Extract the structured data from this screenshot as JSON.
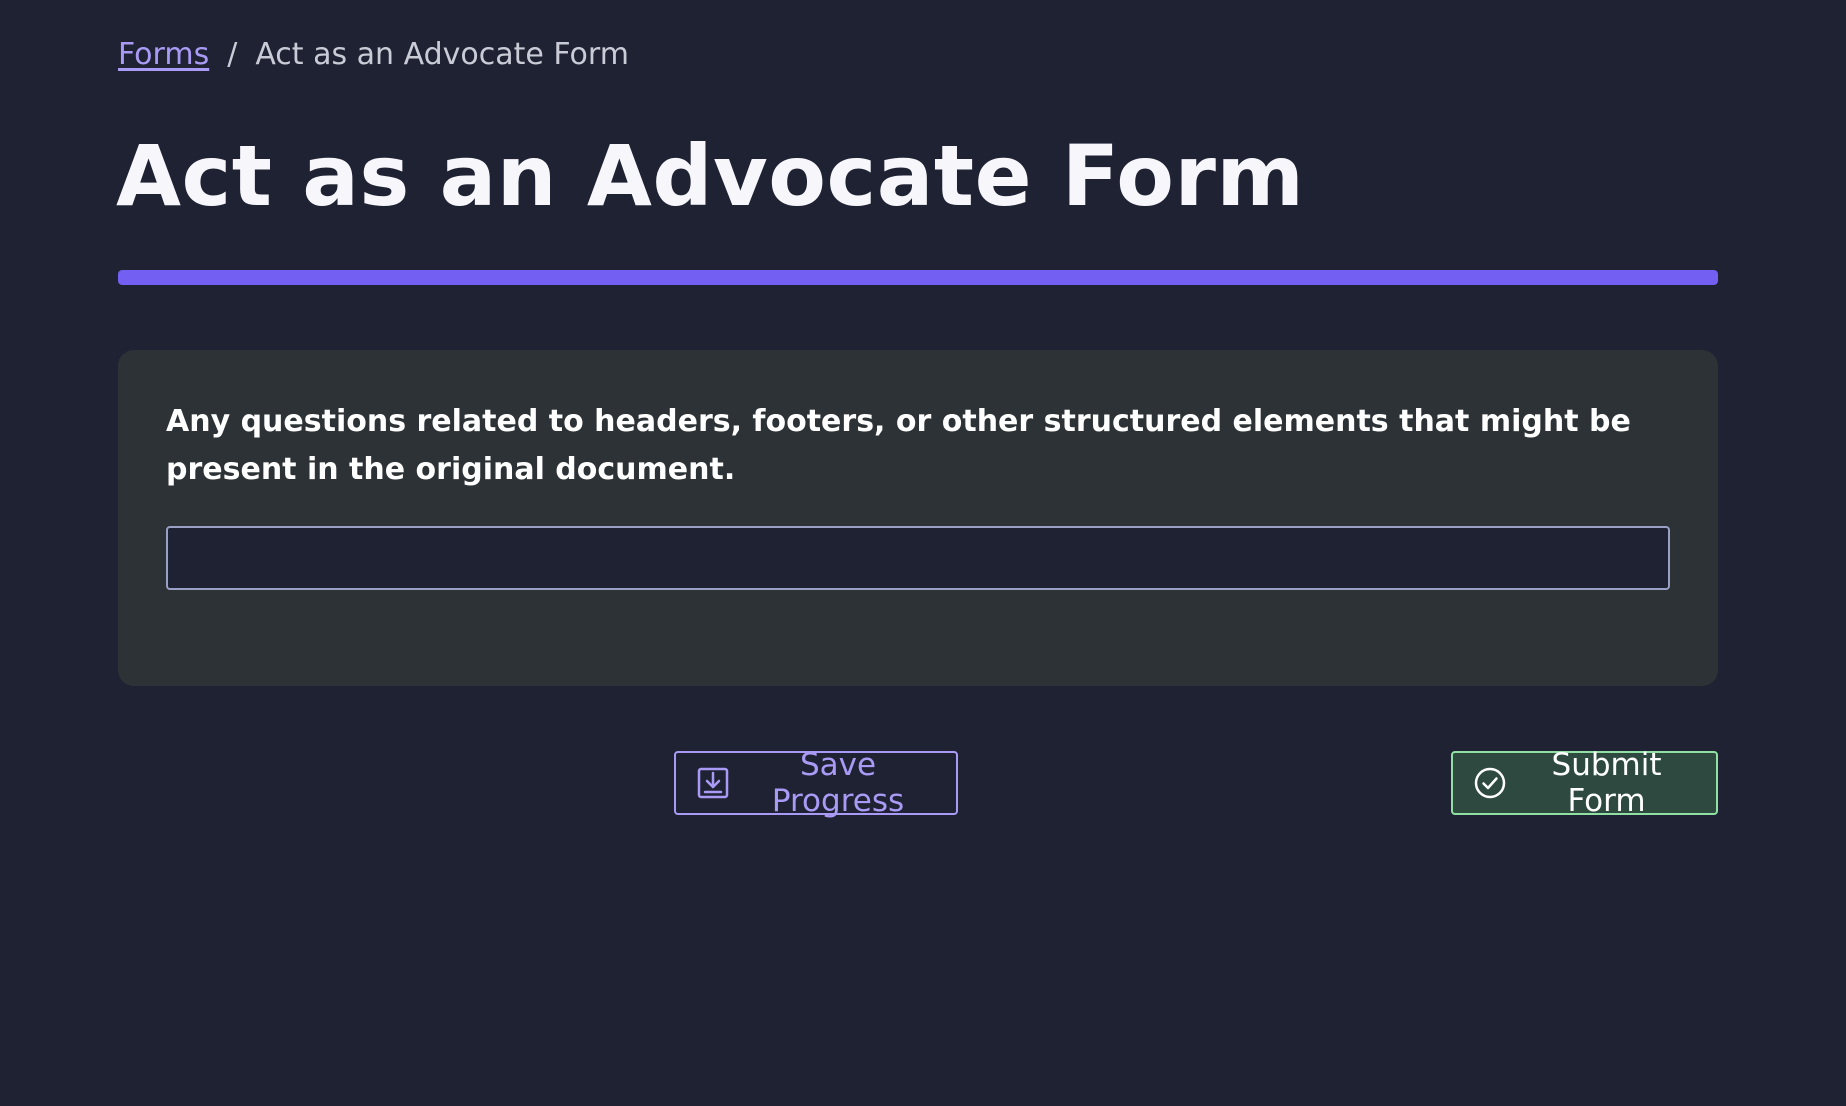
{
  "breadcrumb": {
    "parent_label": "Forms",
    "separator": "/",
    "current_label": "Act as an Advocate Form"
  },
  "page": {
    "title": "Act as an Advocate Form"
  },
  "progress": {
    "fraction": 1.0,
    "color": "#7360f2"
  },
  "question": {
    "label": "Any questions related to headers, footers, or other structured elements that might be present in the original document.",
    "value": "",
    "placeholder": ""
  },
  "actions": {
    "save_label": "Save Progress",
    "save_icon": "save-download-icon",
    "submit_label": "Submit Form",
    "submit_icon": "check-circle-icon"
  },
  "colors": {
    "background": "#1e2233",
    "card": "#2c3235",
    "accent": "#a99bf5",
    "success_border": "#8fe0a2"
  }
}
